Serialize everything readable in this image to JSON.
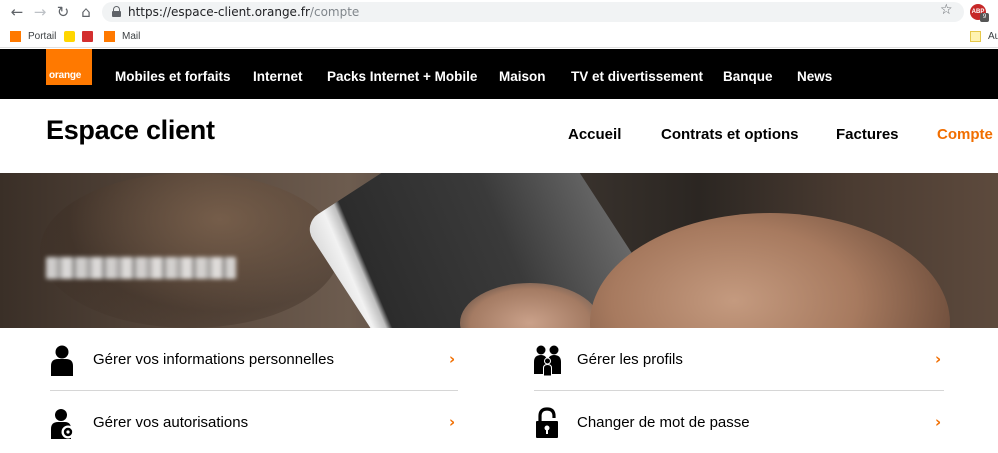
{
  "browser": {
    "url_host": "https://espace-client.orange.fr",
    "url_path": "/compte",
    "ext_badge": "9",
    "ext_label": "ABP"
  },
  "bookmarks": [
    {
      "label": "Portail",
      "icon": "orange-square-icon"
    },
    {
      "label": "",
      "icon": "smiley-icon"
    },
    {
      "label": "",
      "icon": "red-book-icon"
    },
    {
      "label": "Mail",
      "icon": "orange-square-icon"
    },
    {
      "label": "Au",
      "icon": "note-icon"
    }
  ],
  "topnav": {
    "logo": "orange",
    "items": [
      "Mobiles et forfaits",
      "Internet",
      "Packs Internet + Mobile",
      "Maison",
      "TV et divertissement",
      "Banque",
      "News"
    ]
  },
  "header": {
    "title": "Espace client",
    "nav": [
      "Accueil",
      "Contrats et options",
      "Factures",
      "Compte"
    ],
    "active": "Compte"
  },
  "links": [
    {
      "label": "Gérer vos informations personnelles",
      "icon": "person-icon",
      "chevron": "›"
    },
    {
      "label": "Gérer les profils",
      "icon": "family-icon",
      "chevron": "›"
    },
    {
      "label": "Gérer vos autorisations",
      "icon": "person-settings-icon",
      "chevron": "›"
    },
    {
      "label": "Changer de mot de passe",
      "icon": "padlock-icon",
      "chevron": "›"
    }
  ],
  "colors": {
    "brand": "#ff7900",
    "active_nav": "#f16e00",
    "topnav_bg": "#000000"
  }
}
